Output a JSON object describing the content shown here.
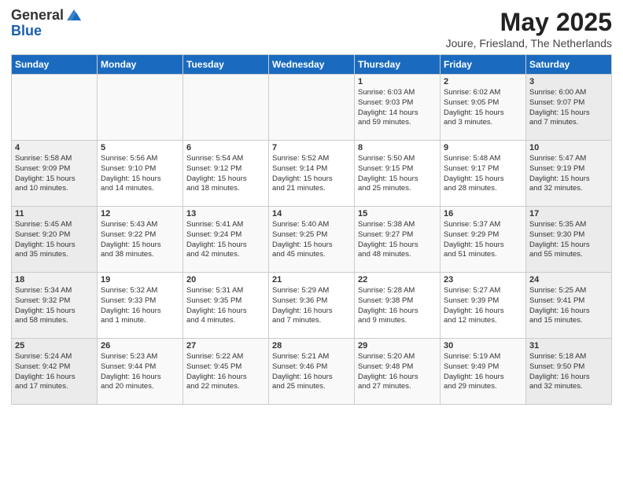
{
  "header": {
    "logo_general": "General",
    "logo_blue": "Blue",
    "title": "May 2025",
    "subtitle": "Joure, Friesland, The Netherlands"
  },
  "weekdays": [
    "Sunday",
    "Monday",
    "Tuesday",
    "Wednesday",
    "Thursday",
    "Friday",
    "Saturday"
  ],
  "weeks": [
    [
      {
        "day": "",
        "info": ""
      },
      {
        "day": "",
        "info": ""
      },
      {
        "day": "",
        "info": ""
      },
      {
        "day": "",
        "info": ""
      },
      {
        "day": "1",
        "info": "Sunrise: 6:03 AM\nSunset: 9:03 PM\nDaylight: 14 hours\nand 59 minutes."
      },
      {
        "day": "2",
        "info": "Sunrise: 6:02 AM\nSunset: 9:05 PM\nDaylight: 15 hours\nand 3 minutes."
      },
      {
        "day": "3",
        "info": "Sunrise: 6:00 AM\nSunset: 9:07 PM\nDaylight: 15 hours\nand 7 minutes."
      }
    ],
    [
      {
        "day": "4",
        "info": "Sunrise: 5:58 AM\nSunset: 9:09 PM\nDaylight: 15 hours\nand 10 minutes."
      },
      {
        "day": "5",
        "info": "Sunrise: 5:56 AM\nSunset: 9:10 PM\nDaylight: 15 hours\nand 14 minutes."
      },
      {
        "day": "6",
        "info": "Sunrise: 5:54 AM\nSunset: 9:12 PM\nDaylight: 15 hours\nand 18 minutes."
      },
      {
        "day": "7",
        "info": "Sunrise: 5:52 AM\nSunset: 9:14 PM\nDaylight: 15 hours\nand 21 minutes."
      },
      {
        "day": "8",
        "info": "Sunrise: 5:50 AM\nSunset: 9:15 PM\nDaylight: 15 hours\nand 25 minutes."
      },
      {
        "day": "9",
        "info": "Sunrise: 5:48 AM\nSunset: 9:17 PM\nDaylight: 15 hours\nand 28 minutes."
      },
      {
        "day": "10",
        "info": "Sunrise: 5:47 AM\nSunset: 9:19 PM\nDaylight: 15 hours\nand 32 minutes."
      }
    ],
    [
      {
        "day": "11",
        "info": "Sunrise: 5:45 AM\nSunset: 9:20 PM\nDaylight: 15 hours\nand 35 minutes."
      },
      {
        "day": "12",
        "info": "Sunrise: 5:43 AM\nSunset: 9:22 PM\nDaylight: 15 hours\nand 38 minutes."
      },
      {
        "day": "13",
        "info": "Sunrise: 5:41 AM\nSunset: 9:24 PM\nDaylight: 15 hours\nand 42 minutes."
      },
      {
        "day": "14",
        "info": "Sunrise: 5:40 AM\nSunset: 9:25 PM\nDaylight: 15 hours\nand 45 minutes."
      },
      {
        "day": "15",
        "info": "Sunrise: 5:38 AM\nSunset: 9:27 PM\nDaylight: 15 hours\nand 48 minutes."
      },
      {
        "day": "16",
        "info": "Sunrise: 5:37 AM\nSunset: 9:29 PM\nDaylight: 15 hours\nand 51 minutes."
      },
      {
        "day": "17",
        "info": "Sunrise: 5:35 AM\nSunset: 9:30 PM\nDaylight: 15 hours\nand 55 minutes."
      }
    ],
    [
      {
        "day": "18",
        "info": "Sunrise: 5:34 AM\nSunset: 9:32 PM\nDaylight: 15 hours\nand 58 minutes."
      },
      {
        "day": "19",
        "info": "Sunrise: 5:32 AM\nSunset: 9:33 PM\nDaylight: 16 hours\nand 1 minute."
      },
      {
        "day": "20",
        "info": "Sunrise: 5:31 AM\nSunset: 9:35 PM\nDaylight: 16 hours\nand 4 minutes."
      },
      {
        "day": "21",
        "info": "Sunrise: 5:29 AM\nSunset: 9:36 PM\nDaylight: 16 hours\nand 7 minutes."
      },
      {
        "day": "22",
        "info": "Sunrise: 5:28 AM\nSunset: 9:38 PM\nDaylight: 16 hours\nand 9 minutes."
      },
      {
        "day": "23",
        "info": "Sunrise: 5:27 AM\nSunset: 9:39 PM\nDaylight: 16 hours\nand 12 minutes."
      },
      {
        "day": "24",
        "info": "Sunrise: 5:25 AM\nSunset: 9:41 PM\nDaylight: 16 hours\nand 15 minutes."
      }
    ],
    [
      {
        "day": "25",
        "info": "Sunrise: 5:24 AM\nSunset: 9:42 PM\nDaylight: 16 hours\nand 17 minutes."
      },
      {
        "day": "26",
        "info": "Sunrise: 5:23 AM\nSunset: 9:44 PM\nDaylight: 16 hours\nand 20 minutes."
      },
      {
        "day": "27",
        "info": "Sunrise: 5:22 AM\nSunset: 9:45 PM\nDaylight: 16 hours\nand 22 minutes."
      },
      {
        "day": "28",
        "info": "Sunrise: 5:21 AM\nSunset: 9:46 PM\nDaylight: 16 hours\nand 25 minutes."
      },
      {
        "day": "29",
        "info": "Sunrise: 5:20 AM\nSunset: 9:48 PM\nDaylight: 16 hours\nand 27 minutes."
      },
      {
        "day": "30",
        "info": "Sunrise: 5:19 AM\nSunset: 9:49 PM\nDaylight: 16 hours\nand 29 minutes."
      },
      {
        "day": "31",
        "info": "Sunrise: 5:18 AM\nSunset: 9:50 PM\nDaylight: 16 hours\nand 32 minutes."
      }
    ]
  ]
}
